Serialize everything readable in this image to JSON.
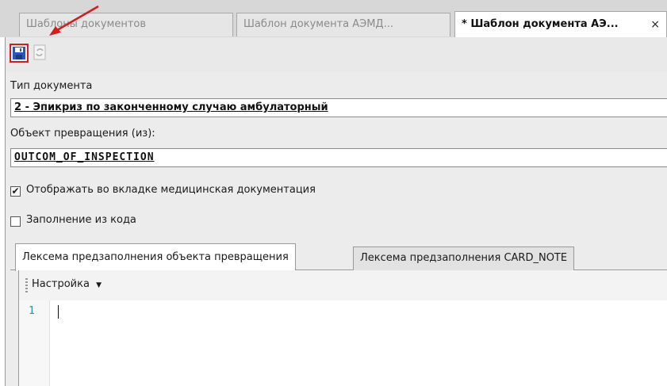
{
  "tabs": [
    {
      "label": "Шаблоны документов",
      "active": false
    },
    {
      "label": "Шаблон документа АЭМД...",
      "active": false
    },
    {
      "label": "* Шаблон документа АЭ...",
      "active": true,
      "close": "×"
    }
  ],
  "toolbar": {
    "save_icon": "floppy-disk-icon",
    "refresh_icon": "refresh-icon",
    "highlight_color": "#d11f1f"
  },
  "form": {
    "doc_type_label": "Тип документа",
    "doc_type_value": "2 - Эпикриз по законченному случаю амбулаторный",
    "object_label": "Объект превращения (из):",
    "object_value": "OUTCOM_OF_INSPECTION",
    "show_in_tab_label": "Отображать во вкладке медицинская документация",
    "show_in_tab_checked": true,
    "fill_from_code_label": "Заполнение из кода",
    "fill_from_code_checked": false
  },
  "inner_tabs": [
    {
      "label": "Лексема предзаполнения объекта превращения",
      "active": true
    },
    {
      "label": "Лексема предзаполнения CARD_NOTE",
      "active": false
    }
  ],
  "editor": {
    "settings_label": "Настройка",
    "line_number": "1"
  }
}
